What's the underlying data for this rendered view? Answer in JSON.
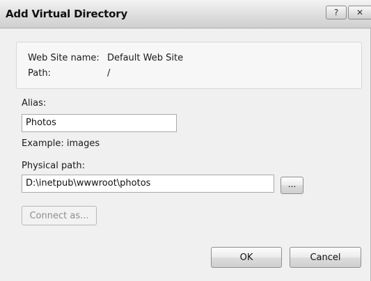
{
  "dialog": {
    "title": "Add Virtual Directory",
    "help_glyph": "?",
    "close_glyph": "✕"
  },
  "info": {
    "site_name_label": "Web Site name:",
    "site_name_value": "Default Web Site",
    "path_label": "Path:",
    "path_value": "/"
  },
  "alias": {
    "label": "Alias:",
    "value": "Photos",
    "example": "Example: images"
  },
  "physical_path": {
    "label": "Physical path:",
    "value": "D:\\inetpub\\wwwroot\\photos",
    "browse_label": "..."
  },
  "buttons": {
    "connect_as": "Connect as...",
    "ok": "OK",
    "cancel": "Cancel"
  }
}
